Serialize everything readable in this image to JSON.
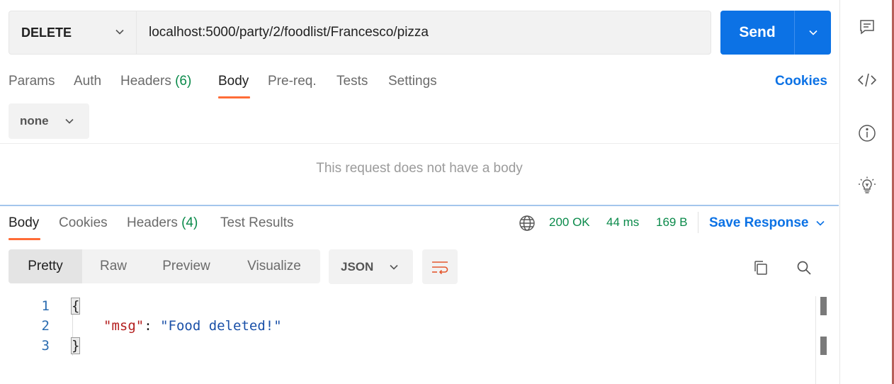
{
  "request": {
    "method": "DELETE",
    "url": "localhost:5000/party/2/foodlist/Francesco/pizza",
    "send_label": "Send"
  },
  "request_tabs": {
    "params": "Params",
    "auth": "Auth",
    "headers": "Headers",
    "headers_count": "(6)",
    "body": "Body",
    "prereq": "Pre-req.",
    "tests": "Tests",
    "settings": "Settings",
    "cookies": "Cookies"
  },
  "body_section": {
    "body_type": "none",
    "empty_message": "This request does not have a body"
  },
  "response_tabs": {
    "body": "Body",
    "cookies": "Cookies",
    "headers": "Headers",
    "headers_count": "(4)",
    "test_results": "Test Results"
  },
  "response_status": {
    "status": "200 OK",
    "time": "44 ms",
    "size": "169 B",
    "save_response": "Save Response"
  },
  "view_modes": {
    "pretty": "Pretty",
    "raw": "Raw",
    "preview": "Preview",
    "visualize": "Visualize",
    "format": "JSON"
  },
  "response_body": {
    "line_numbers": [
      "1",
      "2",
      "3"
    ],
    "open_brace": "{",
    "key": "\"msg\"",
    "colon": ": ",
    "value": "\"Food deleted!\"",
    "close_brace": "}"
  },
  "colors": {
    "accent": "#0c72e5",
    "active_tab_underline": "#ff6c37",
    "success": "#0a8a4a"
  },
  "icons": {
    "sidebar": [
      "comments-icon",
      "code-icon",
      "info-icon",
      "lightbulb-icon"
    ],
    "response": [
      "globe-icon",
      "copy-icon",
      "search-icon",
      "wrap-lines-icon"
    ]
  }
}
